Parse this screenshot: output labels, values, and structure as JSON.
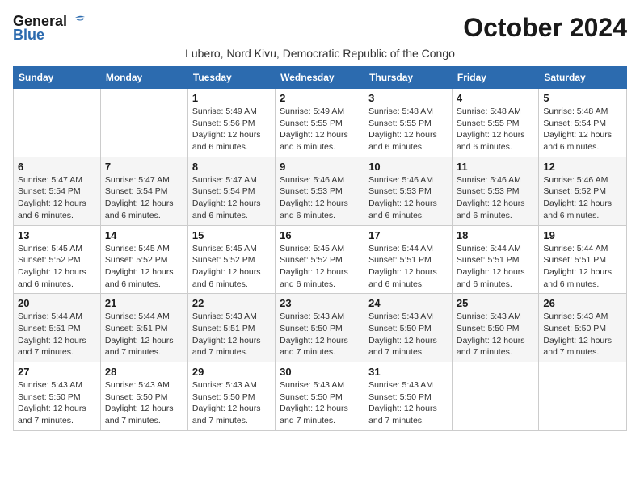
{
  "header": {
    "logo_general": "General",
    "logo_blue": "Blue",
    "month_title": "October 2024",
    "subtitle": "Lubero, Nord Kivu, Democratic Republic of the Congo"
  },
  "days_of_week": [
    "Sunday",
    "Monday",
    "Tuesday",
    "Wednesday",
    "Thursday",
    "Friday",
    "Saturday"
  ],
  "weeks": [
    [
      {
        "day": "",
        "info": ""
      },
      {
        "day": "",
        "info": ""
      },
      {
        "day": "1",
        "info": "Sunrise: 5:49 AM\nSunset: 5:56 PM\nDaylight: 12 hours\nand 6 minutes."
      },
      {
        "day": "2",
        "info": "Sunrise: 5:49 AM\nSunset: 5:55 PM\nDaylight: 12 hours\nand 6 minutes."
      },
      {
        "day": "3",
        "info": "Sunrise: 5:48 AM\nSunset: 5:55 PM\nDaylight: 12 hours\nand 6 minutes."
      },
      {
        "day": "4",
        "info": "Sunrise: 5:48 AM\nSunset: 5:55 PM\nDaylight: 12 hours\nand 6 minutes."
      },
      {
        "day": "5",
        "info": "Sunrise: 5:48 AM\nSunset: 5:54 PM\nDaylight: 12 hours\nand 6 minutes."
      }
    ],
    [
      {
        "day": "6",
        "info": "Sunrise: 5:47 AM\nSunset: 5:54 PM\nDaylight: 12 hours\nand 6 minutes."
      },
      {
        "day": "7",
        "info": "Sunrise: 5:47 AM\nSunset: 5:54 PM\nDaylight: 12 hours\nand 6 minutes."
      },
      {
        "day": "8",
        "info": "Sunrise: 5:47 AM\nSunset: 5:54 PM\nDaylight: 12 hours\nand 6 minutes."
      },
      {
        "day": "9",
        "info": "Sunrise: 5:46 AM\nSunset: 5:53 PM\nDaylight: 12 hours\nand 6 minutes."
      },
      {
        "day": "10",
        "info": "Sunrise: 5:46 AM\nSunset: 5:53 PM\nDaylight: 12 hours\nand 6 minutes."
      },
      {
        "day": "11",
        "info": "Sunrise: 5:46 AM\nSunset: 5:53 PM\nDaylight: 12 hours\nand 6 minutes."
      },
      {
        "day": "12",
        "info": "Sunrise: 5:46 AM\nSunset: 5:52 PM\nDaylight: 12 hours\nand 6 minutes."
      }
    ],
    [
      {
        "day": "13",
        "info": "Sunrise: 5:45 AM\nSunset: 5:52 PM\nDaylight: 12 hours\nand 6 minutes."
      },
      {
        "day": "14",
        "info": "Sunrise: 5:45 AM\nSunset: 5:52 PM\nDaylight: 12 hours\nand 6 minutes."
      },
      {
        "day": "15",
        "info": "Sunrise: 5:45 AM\nSunset: 5:52 PM\nDaylight: 12 hours\nand 6 minutes."
      },
      {
        "day": "16",
        "info": "Sunrise: 5:45 AM\nSunset: 5:52 PM\nDaylight: 12 hours\nand 6 minutes."
      },
      {
        "day": "17",
        "info": "Sunrise: 5:44 AM\nSunset: 5:51 PM\nDaylight: 12 hours\nand 6 minutes."
      },
      {
        "day": "18",
        "info": "Sunrise: 5:44 AM\nSunset: 5:51 PM\nDaylight: 12 hours\nand 6 minutes."
      },
      {
        "day": "19",
        "info": "Sunrise: 5:44 AM\nSunset: 5:51 PM\nDaylight: 12 hours\nand 6 minutes."
      }
    ],
    [
      {
        "day": "20",
        "info": "Sunrise: 5:44 AM\nSunset: 5:51 PM\nDaylight: 12 hours\nand 7 minutes."
      },
      {
        "day": "21",
        "info": "Sunrise: 5:44 AM\nSunset: 5:51 PM\nDaylight: 12 hours\nand 7 minutes."
      },
      {
        "day": "22",
        "info": "Sunrise: 5:43 AM\nSunset: 5:51 PM\nDaylight: 12 hours\nand 7 minutes."
      },
      {
        "day": "23",
        "info": "Sunrise: 5:43 AM\nSunset: 5:50 PM\nDaylight: 12 hours\nand 7 minutes."
      },
      {
        "day": "24",
        "info": "Sunrise: 5:43 AM\nSunset: 5:50 PM\nDaylight: 12 hours\nand 7 minutes."
      },
      {
        "day": "25",
        "info": "Sunrise: 5:43 AM\nSunset: 5:50 PM\nDaylight: 12 hours\nand 7 minutes."
      },
      {
        "day": "26",
        "info": "Sunrise: 5:43 AM\nSunset: 5:50 PM\nDaylight: 12 hours\nand 7 minutes."
      }
    ],
    [
      {
        "day": "27",
        "info": "Sunrise: 5:43 AM\nSunset: 5:50 PM\nDaylight: 12 hours\nand 7 minutes."
      },
      {
        "day": "28",
        "info": "Sunrise: 5:43 AM\nSunset: 5:50 PM\nDaylight: 12 hours\nand 7 minutes."
      },
      {
        "day": "29",
        "info": "Sunrise: 5:43 AM\nSunset: 5:50 PM\nDaylight: 12 hours\nand 7 minutes."
      },
      {
        "day": "30",
        "info": "Sunrise: 5:43 AM\nSunset: 5:50 PM\nDaylight: 12 hours\nand 7 minutes."
      },
      {
        "day": "31",
        "info": "Sunrise: 5:43 AM\nSunset: 5:50 PM\nDaylight: 12 hours\nand 7 minutes."
      },
      {
        "day": "",
        "info": ""
      },
      {
        "day": "",
        "info": ""
      }
    ]
  ]
}
